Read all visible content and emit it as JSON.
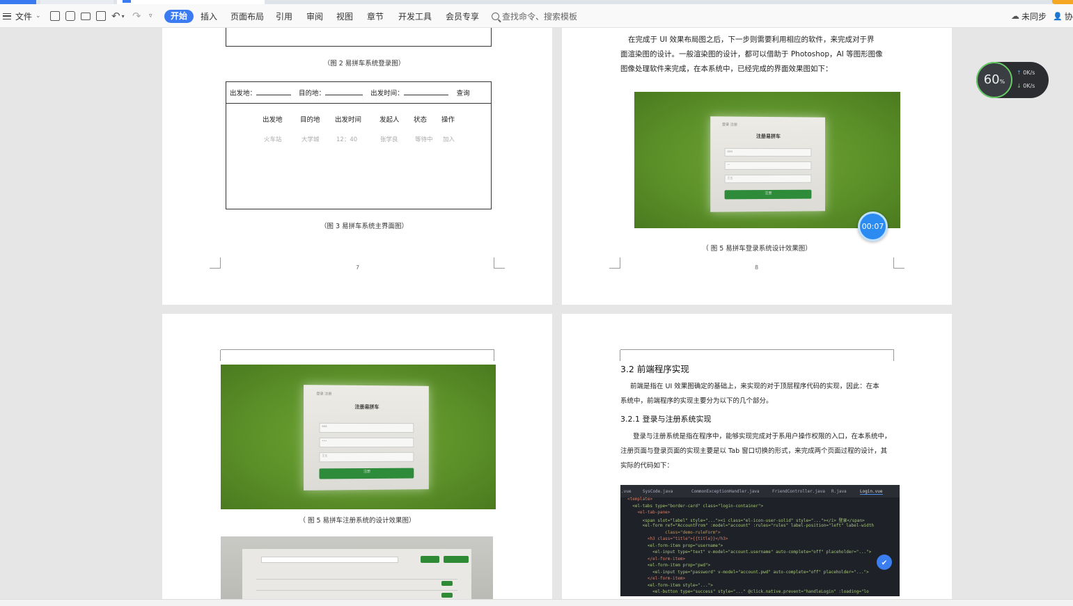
{
  "toolbar": {
    "file_label": "文件",
    "tabs": [
      "开始",
      "插入",
      "页面布局",
      "引用",
      "审阅",
      "视图",
      "章节",
      "开发工具",
      "会员专享"
    ],
    "search_placeholder": "查找命令、搜索模板",
    "sync_label": "未同步",
    "collab_label": "协"
  },
  "page7": {
    "caption_fig2": "（图 2 易拼车系统登录图）",
    "query": {
      "from_label": "出发地：",
      "to_label": "目的地：",
      "time_label": "出发时间：",
      "query_label": "查询"
    },
    "table_headers": [
      "出发地",
      "目的地",
      "出发时间",
      "发起人",
      "状态",
      "操作"
    ],
    "table_row": [
      "火车站",
      "大学城",
      "12：40",
      "张学良",
      "等待中",
      "加入"
    ],
    "caption_fig3": "（图 3 易拼车系统主界面图）",
    "page_number": "7"
  },
  "page8": {
    "paragraph": [
      "在完成于 UI 效果布局图之后，下一步则需要利用相应的软件，来完成对于界",
      "面渲染图的设计。一般渲染图的设计，都可以借助于 Photoshop，AI 等图形图像",
      "图像处理软件来完成，在本系统中，已经完成的界面效果图如下："
    ],
    "caption_fig5": "（ 图 5 易拼车登录系统设计效果图）",
    "page_number": "8",
    "photo_card": {
      "tabs": "登录  注册",
      "title": "注册易拼车",
      "fields": [
        "aaa",
        "—",
        "王五"
      ],
      "button": "注册"
    }
  },
  "page9": {
    "caption_fig5": "（ 图 5 易拼车注册系统的设计效果图）",
    "photo_card": {
      "tabs": "登录   注册",
      "title": "注册易拼车",
      "fields": [
        "aaa",
        "•••",
        "王五"
      ],
      "button": "注册"
    }
  },
  "page10": {
    "heading": "3.2  前端程序实现",
    "para1": [
      "前端是指在 UI 效果图确定的基础上，来实现的对于顶层程序代码的实现，因此：在本",
      "系统中，前端程序的实现主要分为以下的几个部分。"
    ],
    "subheading": "3.2.1  登录与注册系统实现",
    "para2": [
      "登录与注册系统是指在程序中，能够实现完成对于系用户操作权限的入口，在本系统中，",
      "注册页面与登录页面的实现主要是以 Tab 窗口切换的形式，来完成两个页面过程的设计，其",
      "实际的代码如下："
    ],
    "code_tabs": [
      ".vue",
      "SysCode.java",
      "CommonExceptionHandler.java",
      "FriendController.java",
      "R.java",
      "Login.vue"
    ],
    "code_lines": [
      "<template>",
      "  <el-tabs type=\"border-card\" class=\"login-container\">",
      "    <el-tab-pane>",
      "      <span slot=\"label\" style=\"...\"><i class=\"el-icon-user-solid\" style=\"...\"></i> 登录</span>",
      "      <el-form ref=\"AccountFrom\" :model=\"account\" :rules=\"rules\" label-position=\"left\" label-width",
      "               class=\"demo-ruleForm\">",
      "        <h3 class=\"title\">{{title}}</h3>",
      "        <el-form-item prop=\"username\">",
      "          <el-input type=\"text\" v-model=\"account.username\" auto-complete=\"off\" placeholder=\"...\">",
      "        </el-form-item>",
      "        <el-form-item prop=\"pwd\">",
      "          <el-input type=\"password\" v-model=\"account.pwd\" auto-complete=\"off\" placeholder=\"...\">",
      "        </el-form-item>",
      "        <el-form-item style=\"...\">",
      "          <el-button type=\"success\" style=\"...\" @click.native.prevent=\"handleLogin\" :loading=\"lo"
    ]
  },
  "overlays": {
    "timer": "00:07",
    "net_percent": "60",
    "net_percent_unit": "%",
    "net_up": "0K/s",
    "net_down": "0K/s"
  },
  "colors": {
    "accent": "#3b7bf2",
    "photo_green": "#5a8f28",
    "timer_blue": "#2b8bf0"
  }
}
